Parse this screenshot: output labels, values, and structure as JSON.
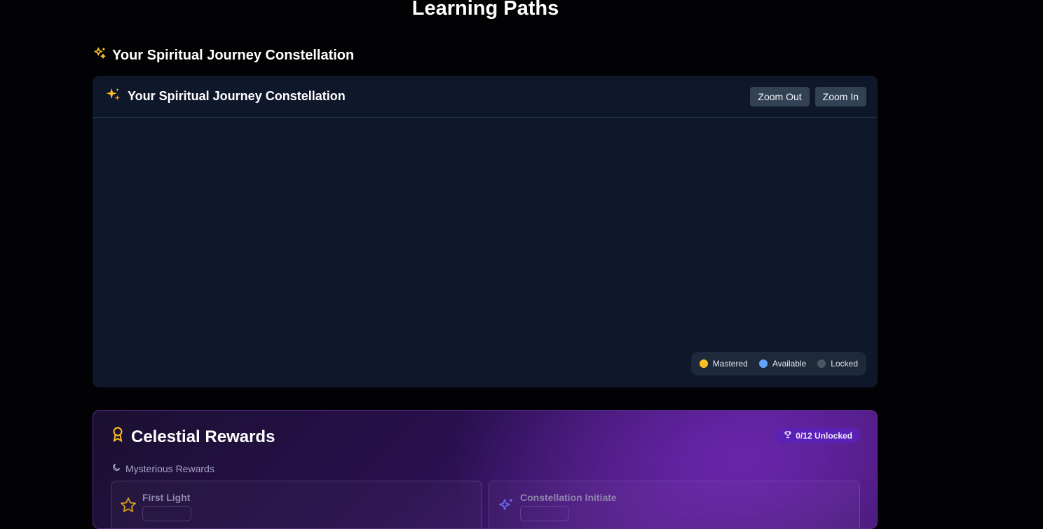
{
  "page": {
    "title": "Learning Paths"
  },
  "section": {
    "title": "Your Spiritual Journey Constellation",
    "icon": "sparkles-icon"
  },
  "constellation_panel": {
    "title": "Your Spiritual Journey Constellation",
    "icon": "sparkles-emoji-icon",
    "zoom_out_label": "Zoom Out",
    "zoom_in_label": "Zoom In",
    "legend": [
      {
        "label": "Mastered",
        "color": "#fbbf24"
      },
      {
        "label": "Available",
        "color": "#60a5fa"
      },
      {
        "label": "Locked",
        "color": "#4b5563"
      }
    ]
  },
  "rewards": {
    "title": "Celestial Rewards",
    "icon": "award-icon",
    "badge": "0/12 Unlocked",
    "subtitle": "Mysterious Rewards",
    "cards": [
      {
        "name": "First Light",
        "icon": "star-icon"
      },
      {
        "name": "Constellation Initiate",
        "icon": "sparkles-icon"
      }
    ]
  },
  "colors": {
    "background": "#020205",
    "panel": "#0f172a",
    "button": "#334155",
    "rewards_accent": "#5b21b6",
    "gold": "#fbbf24"
  }
}
